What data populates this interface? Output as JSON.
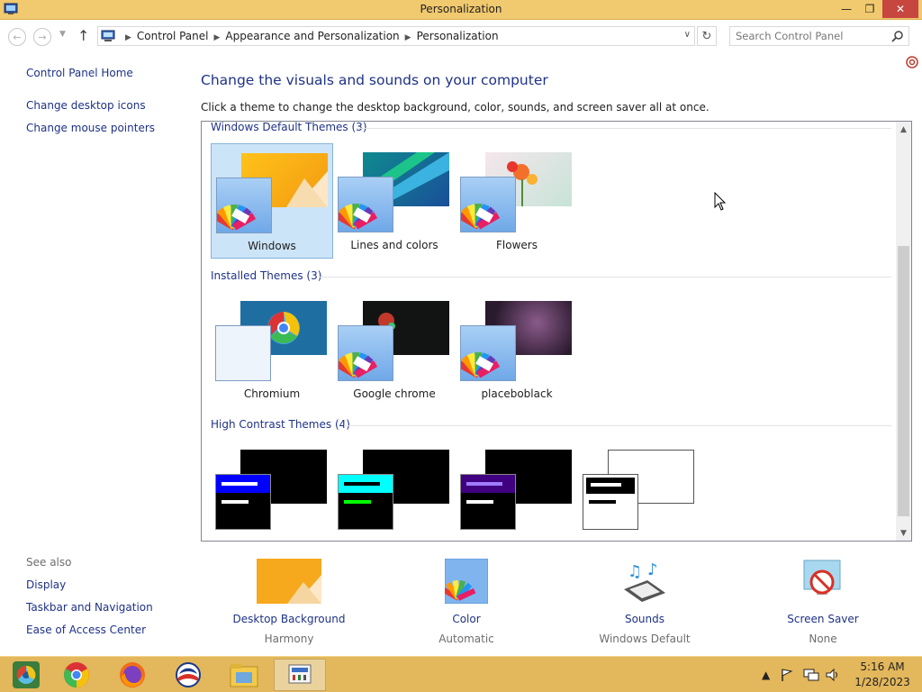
{
  "window": {
    "title": "Personalization",
    "minimize_glyph": "—",
    "maximize_glyph": "❐",
    "close_glyph": "✕"
  },
  "navigation": {
    "breadcrumbs": [
      "Control Panel",
      "Appearance and Personalization",
      "Personalization"
    ],
    "search_placeholder": "Search Control Panel"
  },
  "sidebar": {
    "home_label": "Control Panel Home",
    "links": [
      "Change desktop icons",
      "Change mouse pointers"
    ],
    "see_also_label": "See also",
    "see_also_links": [
      "Display",
      "Taskbar and Navigation",
      "Ease of Access Center"
    ]
  },
  "main": {
    "heading": "Change the visuals and sounds on your computer",
    "subtitle": "Click a theme to change the desktop background, color, sounds, and screen saver all at once."
  },
  "theme_groups": [
    {
      "label": "Windows Default Themes (3)",
      "themes": [
        {
          "name": "Windows",
          "selected": true
        },
        {
          "name": "Lines and colors",
          "selected": false
        },
        {
          "name": "Flowers",
          "selected": false
        }
      ]
    },
    {
      "label": "Installed Themes (3)",
      "themes": [
        {
          "name": "Chromium",
          "selected": false
        },
        {
          "name": "Google chrome",
          "selected": false
        },
        {
          "name": "placeboblack",
          "selected": false
        }
      ]
    },
    {
      "label": "High Contrast Themes (4)",
      "themes": [
        {
          "header_color": "#0000ff",
          "bar_color": "#ffffff"
        },
        {
          "header_color": "#00ffff",
          "bar_color": "#00ff00"
        },
        {
          "header_color": "#400080",
          "bar_color": "#ffffff"
        },
        {
          "header_color": "#ffffff",
          "bar_color": "#000000"
        }
      ]
    }
  ],
  "settings": [
    {
      "label": "Desktop Background",
      "value": "Harmony",
      "icon": "desktop-background-icon"
    },
    {
      "label": "Color",
      "value": "Automatic",
      "icon": "color-palette-icon"
    },
    {
      "label": "Sounds",
      "value": "Windows Default",
      "icon": "sounds-icon"
    },
    {
      "label": "Screen Saver",
      "value": "None",
      "icon": "screen-saver-icon"
    }
  ],
  "taskbar": {
    "apps": [
      "chromium-icon",
      "chrome-icon",
      "firefox-icon",
      "obama-logo-icon",
      "file-explorer-icon",
      "control-panel-icon"
    ],
    "active_app": "control-panel-icon",
    "time": "5:16 AM",
    "date": "1/28/2023"
  },
  "colors": {
    "title_bar": "#f1c96e",
    "taskbar": "#e3b75b",
    "link": "#1e3287",
    "close_button": "#c7463f",
    "selected_tile": "#cce4f7"
  }
}
